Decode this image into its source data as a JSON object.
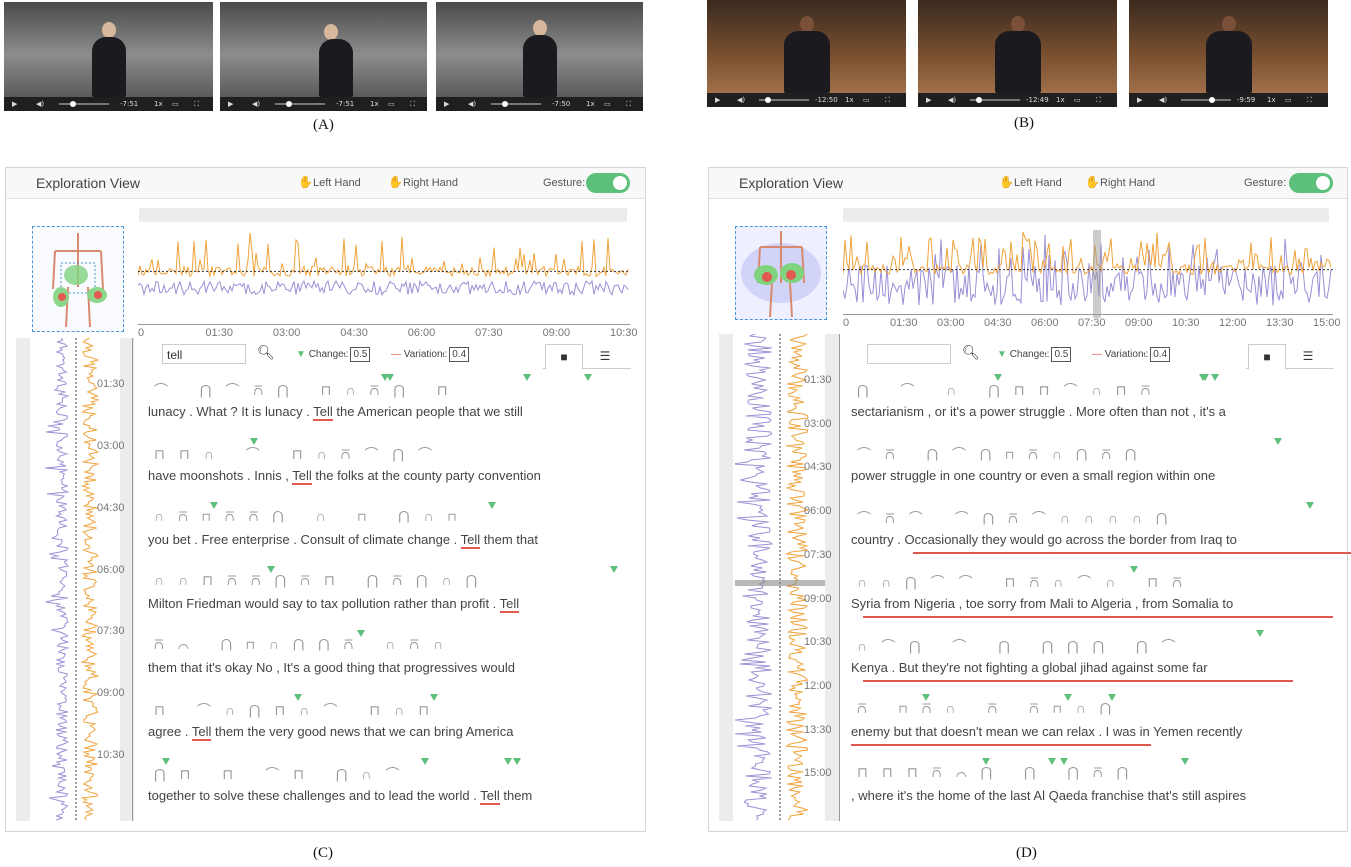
{
  "videos": {
    "a": [
      {
        "time": "-7:51",
        "speed": "1x"
      },
      {
        "time": "-7:51",
        "speed": "1x"
      },
      {
        "time": "-7:50",
        "speed": "1x"
      }
    ],
    "b": [
      {
        "time": "-12:50",
        "speed": "1x"
      },
      {
        "time": "-12:49",
        "speed": "1x"
      },
      {
        "time": "-9:59",
        "speed": "1x"
      }
    ]
  },
  "captions": {
    "a": "(A)",
    "b": "(B)",
    "c": "(C)",
    "d": "(D)"
  },
  "panel_c": {
    "title": "Exploration View",
    "left_hand": "Left Hand",
    "right_hand": "Right Hand",
    "gesture_label": "Gesture:",
    "search_value": "tell",
    "change_label": "Change",
    "change_value": "0.5",
    "variation_label": "Variation",
    "variation_value": "0.4",
    "timeline_ticks": [
      "0",
      "01:30",
      "03:00",
      "04:30",
      "06:00",
      "07:30",
      "09:00",
      "10:30"
    ],
    "side_ticks": [
      "01:30",
      "03:00",
      "04:30",
      "06:00",
      "07:30",
      "09:00",
      "10:30"
    ],
    "lines": [
      {
        "pre": "lunacy . What ? It is lunacy . ",
        "hl": "Tell",
        "post": " the American people that we still"
      },
      {
        "pre": "have moonshots . Innis , ",
        "hl": "Tell",
        "post": " the folks at the county party convention"
      },
      {
        "pre": "you bet . Free enterprise . Consult of climate change . ",
        "hl": "Tell",
        "post": " them that"
      },
      {
        "pre": "Milton Friedman would say to tax pollution rather than profit . ",
        "hl": "Tell",
        "post": ""
      },
      {
        "pre": "them that it's okay No , It's a good thing that progressives would",
        "hl": "",
        "post": ""
      },
      {
        "pre": "agree . ",
        "hl": "Tell",
        "post": " them the very good news that we can bring America"
      },
      {
        "pre": "together to solve these challenges and to lead the world . ",
        "hl": "Tell",
        "post": " them"
      }
    ]
  },
  "panel_d": {
    "title": "Exploration View",
    "left_hand": "Left Hand",
    "right_hand": "Right Hand",
    "gesture_label": "Gesture:",
    "search_value": "",
    "change_label": "Change",
    "change_value": "0.5",
    "variation_label": "Variation",
    "variation_value": "0.4",
    "timeline_ticks": [
      "0",
      "01:30",
      "03:00",
      "04:30",
      "06:00",
      "07:30",
      "09:00",
      "10:30",
      "12:00",
      "13:30",
      "15:00"
    ],
    "side_ticks": [
      "01:30",
      "03:00",
      "04:30",
      "06:00",
      "07:30",
      "09:00",
      "10:30",
      "12:00",
      "13:30",
      "15:00"
    ],
    "lines": [
      "sectarianism , or it's a power struggle . More often than not , it's a",
      "power struggle in one country or even a small region within one",
      "country . Occasionally they would go across the border from Iraq to",
      "Syria from Nigeria , toe sorry from Mali to Algeria , from Somalia to",
      "Kenya . But they're not fighting a global jihad against some far",
      "enemy but that doesn't mean we can relax . I was in Yemen recently",
      ", where it's the home of the last Al Qaeda franchise that's still aspires"
    ]
  },
  "colors": {
    "left": "#f0a23a",
    "right": "#9b8fd6",
    "accent": "#5cbf7a",
    "highlight": "#e25a4f"
  }
}
